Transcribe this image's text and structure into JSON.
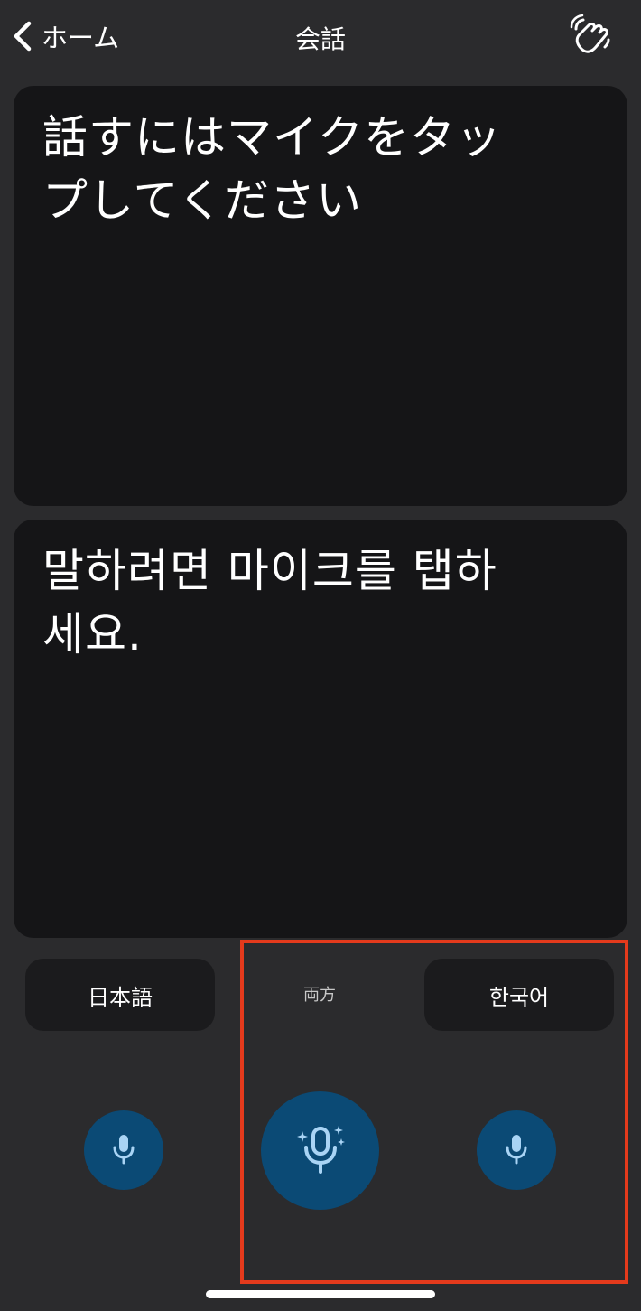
{
  "header": {
    "back_label": "ホーム",
    "title": "会話",
    "icons": {
      "back": "chevron-left-icon",
      "wave": "waving-hand-icon"
    }
  },
  "panels": {
    "top_prompt": "話すにはマイクをタップしてください",
    "bottom_prompt": "말하려면 마이크를 탭하세요."
  },
  "languages": {
    "left": "日本語",
    "both": "両方",
    "right": "한국어"
  },
  "mics": {
    "left_icon": "microphone-icon",
    "center_icon": "microphone-sparkle-icon",
    "right_icon": "microphone-icon"
  },
  "colors": {
    "background": "#2b2b2d",
    "panel": "#151517",
    "mic_button": "#0b4a75",
    "mic_glyph": "#a9d4f5",
    "highlight": "#e43a1c"
  }
}
